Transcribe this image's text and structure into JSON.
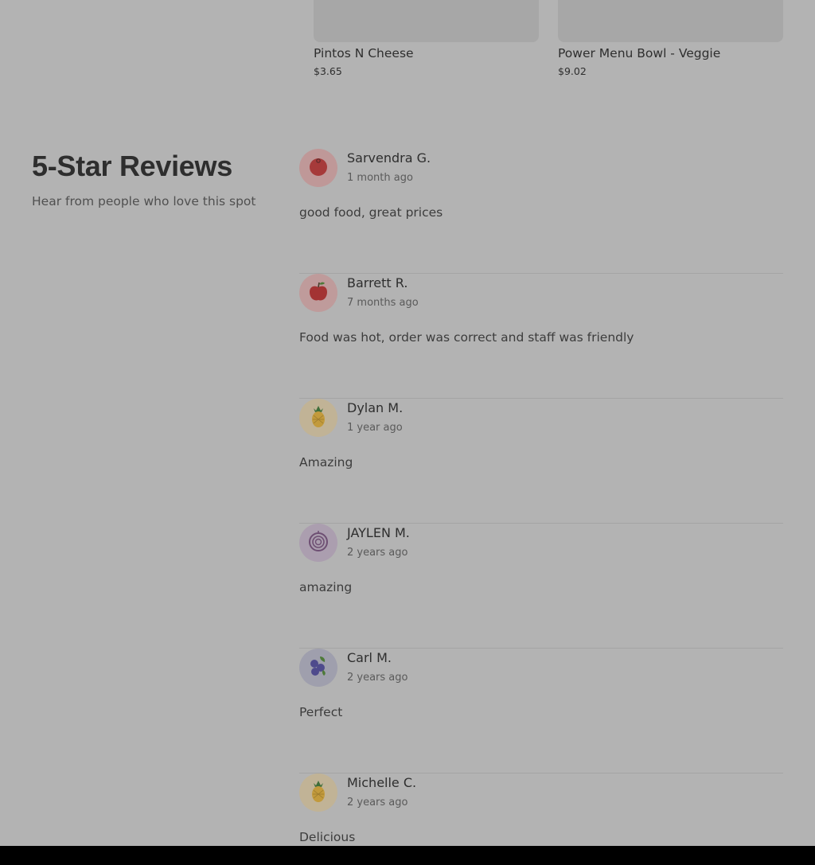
{
  "menu_items": [
    {
      "name": "Pintos N Cheese",
      "price": "$3.65"
    },
    {
      "name": "Power Menu Bowl - Veggie",
      "price": "$9.02"
    }
  ],
  "reviews_section": {
    "title": "5-Star Reviews",
    "subtitle": "Hear from people who love this spot"
  },
  "reviews": [
    {
      "name": "Sarvendra G.",
      "time": "1 month ago",
      "text": "good food, great prices",
      "avatar_icon": "tomato-icon",
      "avatar_bg": "#bf9898"
    },
    {
      "name": "Barrett R.",
      "time": "7 months ago",
      "text": "Food was hot, order was correct and staff was friendly",
      "avatar_icon": "apple-icon",
      "avatar_bg": "#bf9b9b"
    },
    {
      "name": "Dylan M.",
      "time": "1 year ago",
      "text": "Amazing",
      "avatar_icon": "pineapple-icon",
      "avatar_bg": "#c1b396"
    },
    {
      "name": "JAYLEN M.",
      "time": "2 years ago",
      "text": "amazing",
      "avatar_icon": "onion-icon",
      "avatar_bg": "#ab9eaf"
    },
    {
      "name": "Carl M.",
      "time": "2 years ago",
      "text": "Perfect",
      "avatar_icon": "blueberry-icon",
      "avatar_bg": "#9f9fad"
    },
    {
      "name": "Michelle C.",
      "time": "2 years ago",
      "text": "Delicious",
      "avatar_icon": "pineapple-icon",
      "avatar_bg": "#c1b396"
    }
  ]
}
